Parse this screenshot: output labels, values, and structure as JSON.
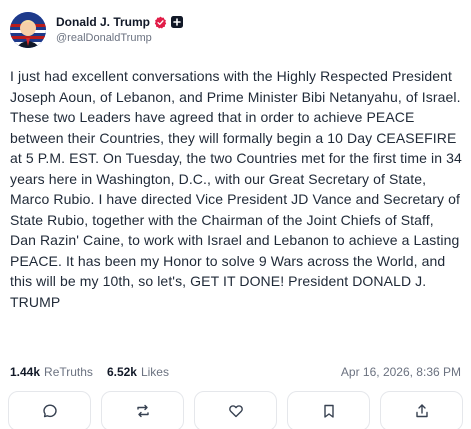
{
  "post": {
    "author": {
      "name": "Donald J. Trump",
      "handle": "@realDonaldTrump"
    },
    "text": "I just had excellent conversations with the Highly Respected President Joseph Aoun, of Lebanon, and Prime Minister Bibi Netanyahu, of Israel. These two Leaders have agreed that in order to achieve PEACE between their Countries, they will formally begin a 10 Day CEASEFIRE at 5 P.M. EST. On Tuesday, the two Countries met for the first time in 34 years here in Washington, D.C., with our Great Secretary of State, Marco Rubio. I have directed Vice President JD Vance and Secretary of State Rubio, together with the Chairman of the Joint Chiefs of Staff, Dan Razin' Caine, to work with Israel and Lebanon to achieve a Lasting PEACE. It has been my Honor to solve 9 Wars across the World, and this will be my 10th, so let's, GET IT DONE! President DONALD J. TRUMP",
    "stats": {
      "retruths_count": "1.44k",
      "retruths_label": "ReTruths",
      "likes_count": "6.52k",
      "likes_label": "Likes"
    },
    "timestamp": "Apr 16, 2026, 8:36 PM"
  },
  "icons": {
    "verified": "verified-badge-icon",
    "plus": "plus-icon",
    "reply": "reply-icon",
    "retruth": "retruth-icon",
    "like": "heart-icon",
    "bookmark": "bookmark-icon",
    "share": "share-icon"
  },
  "colors": {
    "verified": "#e11d48",
    "plus_bg": "#111827",
    "icon": "#374151",
    "muted": "#6b7280",
    "border": "#e5e7eb"
  }
}
